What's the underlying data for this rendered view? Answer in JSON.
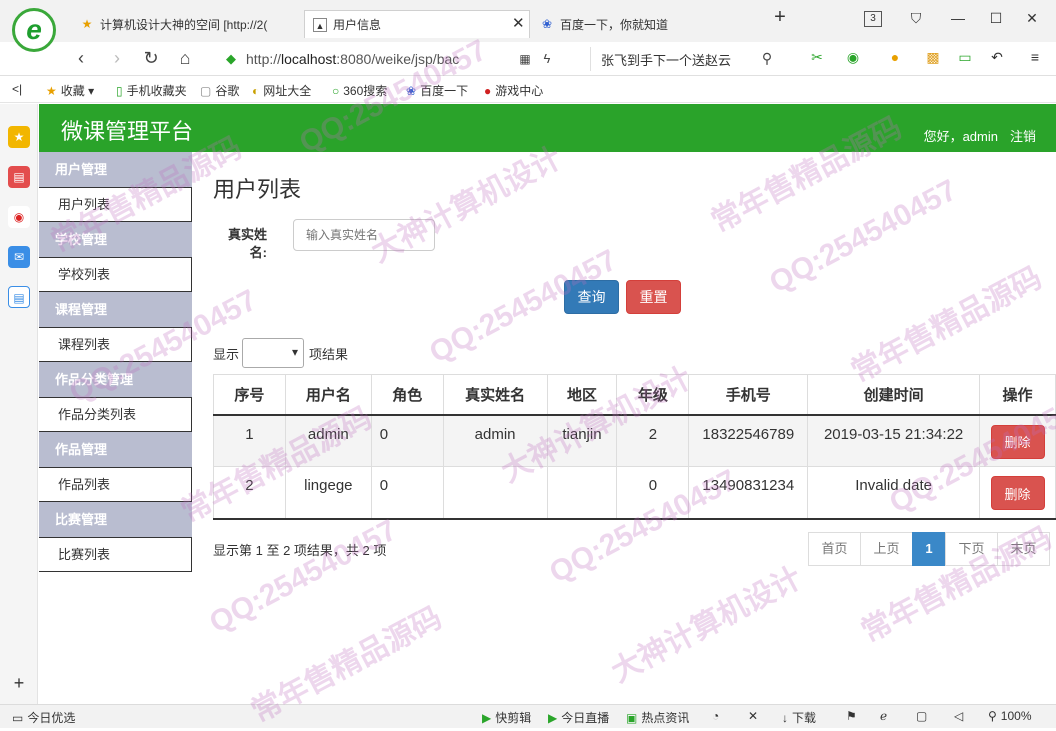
{
  "browser": {
    "logo_letter": "e",
    "tabs": [
      {
        "label": "计算机设计大神的空间 [http://2(",
        "icon": "star-icon"
      },
      {
        "label": "用户信息",
        "icon": "page-icon"
      },
      {
        "label": "百度一下，你就知道",
        "icon": "paw-icon"
      }
    ],
    "tab_count": "3",
    "address": {
      "prefix": "http://",
      "host": "localhost",
      "rest": ":8080/weike/jsp/bac"
    },
    "search_text": "张飞到手下一个送赵云",
    "bookmarks": [
      "收藏",
      "手机收藏夹",
      "谷歌",
      "网址大全",
      "360搜索",
      "百度一下",
      "游戏中心"
    ],
    "status": {
      "left": "今日优选",
      "items": [
        "快剪辑",
        "今日直播",
        "热点资讯",
        "下载"
      ],
      "zoom": "100%"
    }
  },
  "header": {
    "title": "微课管理平台",
    "greeting": "您好，admin",
    "logout": "注销"
  },
  "sidebar": {
    "groups": [
      {
        "title": "用户管理",
        "item": "用户列表"
      },
      {
        "title": "学校管理",
        "item": "学校列表"
      },
      {
        "title": "课程管理",
        "item": "课程列表"
      },
      {
        "title": "作品分类管理",
        "item": "作品分类列表"
      },
      {
        "title": "作品管理",
        "item": "作品列表"
      },
      {
        "title": "比赛管理",
        "item": "比赛列表"
      }
    ]
  },
  "main": {
    "heading": "用户列表",
    "search": {
      "label": "真实姓名:",
      "placeholder": "输入真实姓名"
    },
    "query_label": "查询",
    "reset_label": "重置",
    "length": {
      "prefix": "显示",
      "suffix": "项结果"
    },
    "columns": [
      "序号",
      "用户名",
      "角色",
      "真实姓名",
      "地区",
      "年级",
      "手机号",
      "创建时间",
      "操作"
    ],
    "rows": [
      {
        "no": "1",
        "username": "admin",
        "role": "0",
        "realname": "admin",
        "region": "tianjin",
        "grade": "2",
        "phone": "18322546789",
        "created": "2019-03-15 21:34:22",
        "action": "删除"
      },
      {
        "no": "2",
        "username": "lingege",
        "role": "0",
        "realname": "",
        "region": "",
        "grade": "0",
        "phone": "13490831234",
        "created": "Invalid date",
        "action": "删除"
      }
    ],
    "info": "显示第 1 至 2 项结果，共 2 项",
    "pager": {
      "first": "首页",
      "prev": "上页",
      "current": "1",
      "next": "下页",
      "last": "末页"
    }
  },
  "watermarks": [
    "QQ:254540457",
    "常年售精品源码",
    "大神计算机设计"
  ]
}
